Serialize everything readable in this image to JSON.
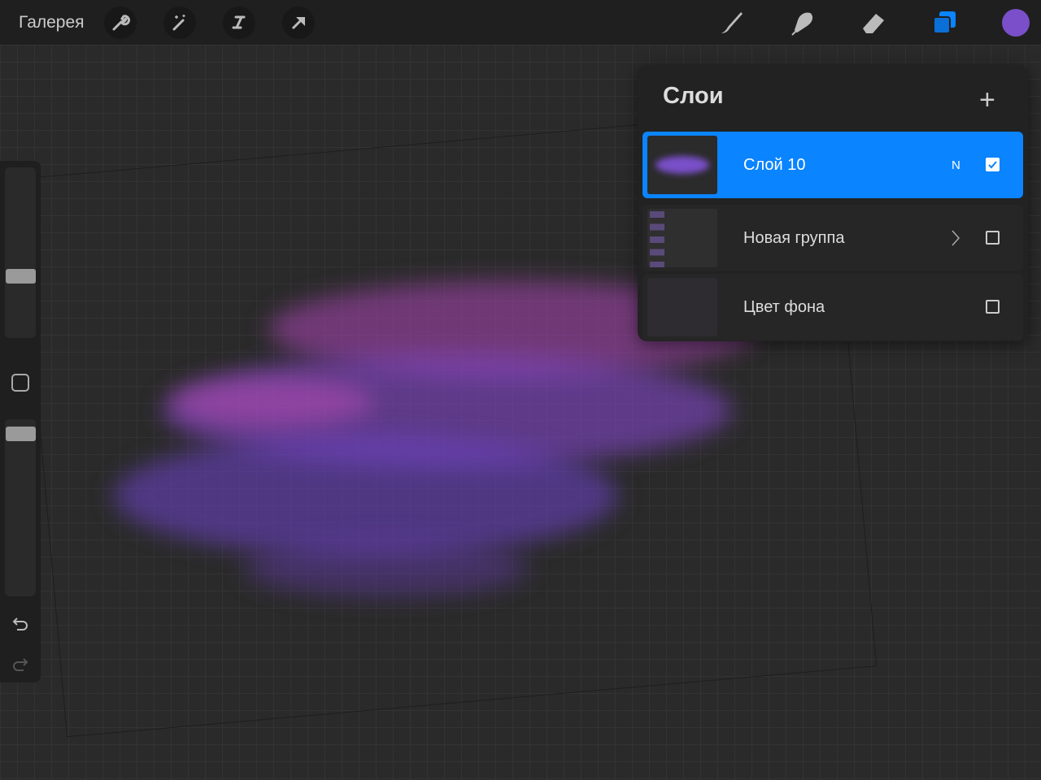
{
  "topbar": {
    "gallery": "Галерея",
    "tools": [
      "wrench-icon",
      "magic-wand-icon",
      "selection-icon",
      "transform-arrow-icon"
    ],
    "right_tools": [
      "brush-icon",
      "smudge-icon",
      "eraser-icon",
      "layers-icon"
    ],
    "current_color": "#7a4fc9"
  },
  "layers_panel": {
    "title": "Слои",
    "add_label": "+",
    "layers": [
      {
        "name": "Слой 10",
        "blend_mode": "N",
        "visible": true,
        "selected": true
      },
      {
        "name": "Новая группа",
        "type": "group",
        "visible": false
      },
      {
        "name": "Цвет фона",
        "visible": false
      }
    ]
  },
  "colors": {
    "accent": "#0a84ff",
    "paint_purple": "#6a3fc0",
    "paint_magenta": "#a03fb0"
  }
}
